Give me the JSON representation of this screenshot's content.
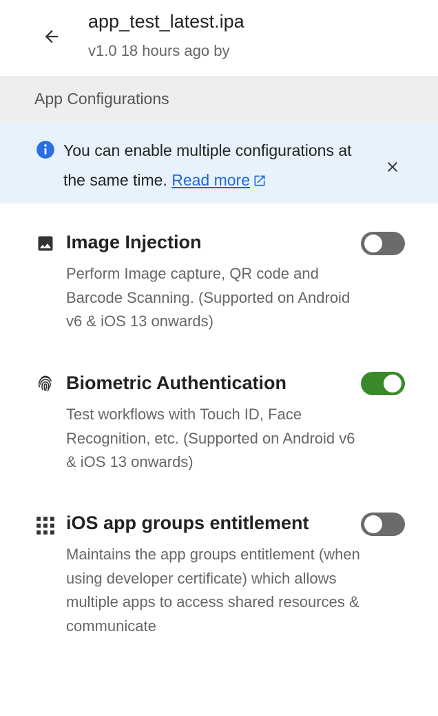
{
  "header": {
    "back_icon": "arrow-left-icon",
    "title": "app_test_latest.ipa",
    "subtitle": "v1.0 18 hours ago by  "
  },
  "section": {
    "title": "App Configurations"
  },
  "banner": {
    "info_icon": "info-icon",
    "text": "You can enable multiple configurations at the same time.",
    "link_label": "Read more",
    "link_icon": "external-link-icon",
    "close_icon": "close-icon",
    "background": "#e7f2fc",
    "link_color": "#2167d1"
  },
  "configs": [
    {
      "icon": "image-icon",
      "title": "Image Injection",
      "description": "Perform Image capture, QR code and Barcode Scanning. (Supported on Android v6 & iOS 13 onwards)",
      "enabled": false
    },
    {
      "icon": "fingerprint-icon",
      "title": "Biometric Authentication",
      "description": "Test workflows with Touch ID, Face Recognition, etc. (Supported on Android v6 & iOS 13 onwards)",
      "enabled": true
    },
    {
      "icon": "grid-icon",
      "title": "iOS app groups entitlement",
      "description": "Maintains the app groups entitlement (when using developer certificate) which allows multiple apps to access shared resources & communicate",
      "enabled": false
    }
  ],
  "colors": {
    "toggle_on": "#3b8a2a",
    "toggle_off": "#6b6b6b",
    "section_bg": "#eeeeee"
  }
}
